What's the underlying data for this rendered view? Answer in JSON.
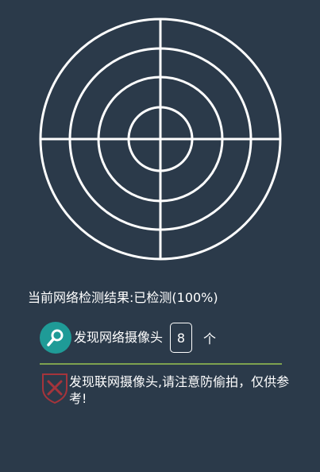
{
  "radar": {
    "icon": "radar-scanner-icon"
  },
  "status": {
    "text": "当前网络检测结果:已检测(100%)"
  },
  "found": {
    "icon": "search-icon",
    "label": "发现网络摄像头",
    "count": "8",
    "unit": "个"
  },
  "warning": {
    "icon": "shield-alert-icon",
    "text": "发现联网摄像头,请注意防偷拍，仅供参考!"
  },
  "colors": {
    "background": "#2b3a4a",
    "radar_stroke": "#ffffff",
    "badge": "#1f9b97",
    "divider": "#7ea24f",
    "alert_red": "#a5343b"
  }
}
